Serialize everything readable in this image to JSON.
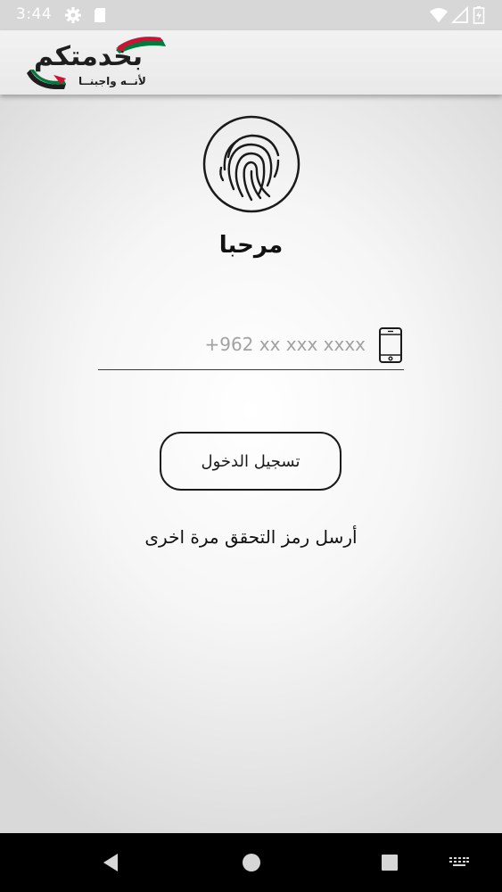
{
  "status_bar": {
    "time": "3:44",
    "icons": [
      "settings-icon",
      "sd-card-icon",
      "wifi-icon",
      "signal-icon",
      "battery-icon"
    ]
  },
  "app_bar": {
    "logo_title": "بخدمتكم",
    "logo_tagline": "لأنــه واجبنــا"
  },
  "login": {
    "welcome": "مرحبا",
    "phone_placeholder": "+962 xx xxx xxxx",
    "phone_value": "",
    "login_button": "تسجيل الدخول",
    "resend_link": "أرسل رمز التحقق مرة اخرى"
  },
  "nav_bar": {
    "buttons": [
      "back-icon",
      "home-icon",
      "recents-icon",
      "keyboard-icon"
    ]
  },
  "colors": {
    "status_bar_bg": "#d7d7d7",
    "nav_bar_bg": "#000000",
    "flag_red": "#d21034",
    "flag_green": "#007a3d",
    "text_dark": "#111111"
  }
}
